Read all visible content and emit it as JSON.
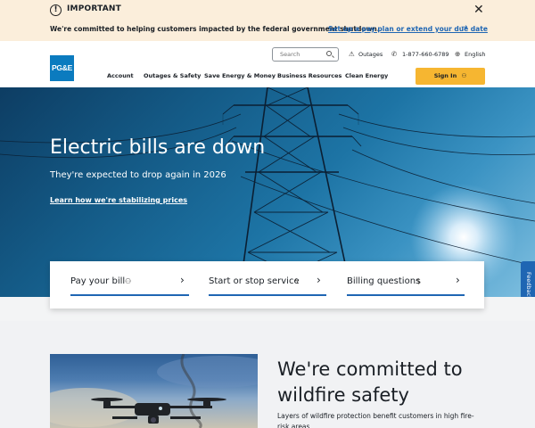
{
  "alert": {
    "icon": "exclamation-icon",
    "title": "IMPORTANT",
    "message": "We're committed to helping customers impacted by the federal government shutdown.",
    "link": "Set up a pay plan or extend your due date",
    "close_icon": "close-icon"
  },
  "header": {
    "logo_text": "PG&E",
    "search_placeholder": "Search",
    "utility": {
      "outages": "Outages",
      "phone": "1-877-660-6789",
      "language": "English"
    },
    "nav": [
      "Account",
      "Outages & Safety",
      "Save Energy & Money",
      "Business Resources",
      "Clean Energy"
    ],
    "sign_in": "Sign In"
  },
  "hero": {
    "title": "Electric bills are down",
    "subtitle": "They're expected to drop again in 2026",
    "link": "Learn how we're stabilizing prices"
  },
  "feedback": "Feedback",
  "quick_links": [
    {
      "label": "Pay your bill",
      "icon": "person-icon"
    },
    {
      "label": "Start or stop service",
      "icon": "bolt-icon"
    },
    {
      "label": "Billing questions",
      "icon": "dollar-icon"
    }
  ],
  "wildfire": {
    "title": "We're committed to wildfire safety",
    "body": "Layers of wildfire protection benefit customers in high fire-risk areas"
  },
  "colors": {
    "alert_bg": "#fbeedb",
    "link_blue": "#1f66b3",
    "signin_yellow": "#f6b631",
    "logo_blue": "#0b7bbf"
  }
}
